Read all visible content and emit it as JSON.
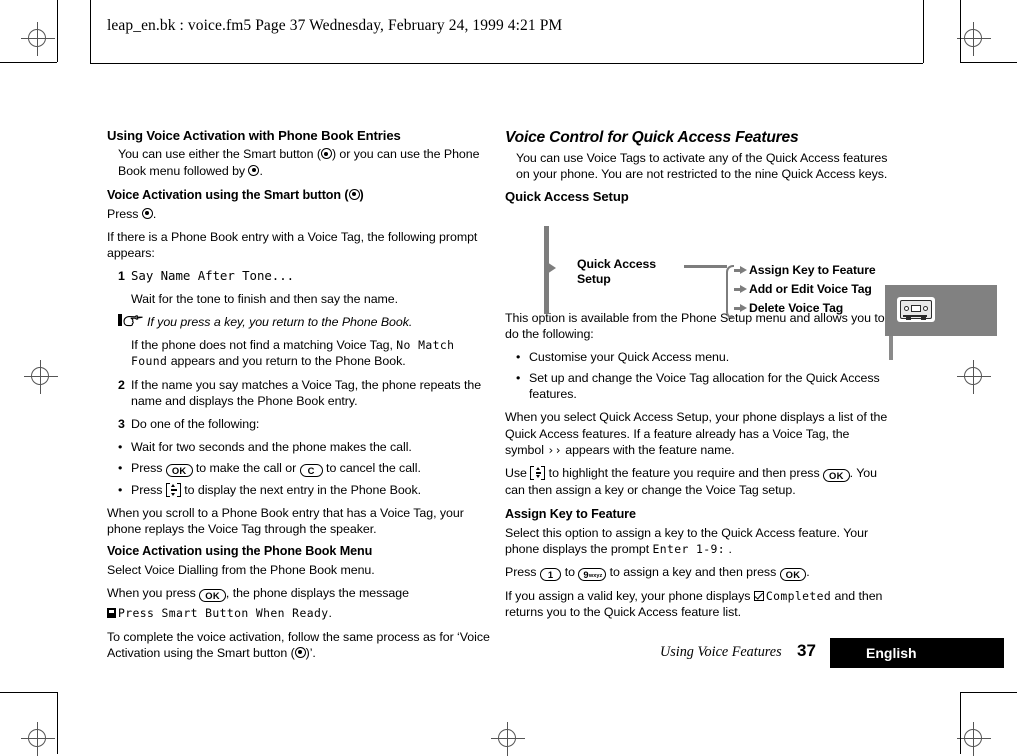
{
  "header": {
    "text": "leap_en.bk : voice.fm5  Page 37  Wednesday, February 24, 1999  4:21 PM"
  },
  "left_column": {
    "heading": "Using Voice Activation with Phone Book Entries",
    "intro_part1": "You can use either the Smart button (",
    "intro_part2": ") or you can use the Phone Book menu followed by ",
    "intro_part3": ".",
    "subheading_smart": "Voice Activation using the Smart button (",
    "subheading_smart_close": ")",
    "press_label": "Press ",
    "press_label_end": ".",
    "prompt_intro": "If there is a Phone Book entry with a Voice Tag, the following prompt appears:",
    "step1_num": "1",
    "step1_lcd": "Say Name After Tone...",
    "step1_body": "Wait for the tone to finish and then say the name.",
    "note_text": "If you press a key, you return to the Phone Book.",
    "nomatch_part1": "If the phone does not find a matching Voice Tag, ",
    "nomatch_lcd1": "No Match",
    "nomatch_lcd2": "Found",
    "nomatch_part2": " appears and you return to the Phone Book.",
    "step2_num": "2",
    "step2_body": "If the name you say matches a Voice Tag, the phone repeats the name and displays the Phone Book entry.",
    "step3_num": "3",
    "step3_body": "Do one of the following:",
    "bullet_dot": "•",
    "b1": "Wait for two seconds and the phone makes the call.",
    "b2_pre": "Press ",
    "b2_key_ok": "OK",
    "b2_mid": " to make the call or ",
    "b2_key_c": "C",
    "b2_end": " to cancel the call.",
    "b3_pre": "Press ",
    "b3_end": " to display the next entry in the Phone Book.",
    "scroll_para": "When you scroll to a Phone Book entry that has a Voice Tag, your phone replays the Voice Tag through the speaker.",
    "subheading_menu": "Voice Activation using the Phone Book Menu",
    "menu_select": "Select Voice Dialling from the Phone Book menu.",
    "menu_press_pre": "When you press ",
    "menu_press_key": "OK",
    "menu_press_post": ", the phone displays the message",
    "menu_lcd": "Press Smart Button When Ready",
    "menu_lcd_period": ".",
    "complete_part1": "To complete the voice activation, follow the same process as for ‘Voice Activation using the Smart button (",
    "complete_part2": ")’."
  },
  "right_column": {
    "heading": "Voice Control for Quick Access Features",
    "intro": "You can use Voice Tags to activate any of the Quick Access features on your phone. You are not restricted to the nine Quick Access keys.",
    "subheading_setup": "Quick Access Setup",
    "option_para": "This option is available from the Phone Setup menu and allows you to do the following:",
    "bullet_dot": "•",
    "b1": "Customise your Quick Access menu.",
    "b2": "Set up and change the Voice Tag allocation for the Quick Access features.",
    "select_part1": "When you select Quick Access Setup, your phone displays a list of the Quick Access features. If a feature already has a Voice Tag, the symbol ",
    "select_symbol": "››",
    "select_part2": " appears with the feature name.",
    "use_pre": "Use ",
    "use_mid": " to highlight the feature you require and then press ",
    "use_key_ok": "OK",
    "use_post": ". You can then assign a key or change the Voice Tag setup.",
    "subheading_assign": "Assign Key to Feature",
    "assign_part1": "Select this option to assign a key to the Quick Access feature. Your phone displays the prompt ",
    "assign_lcd": "Enter 1-9:",
    "assign_part2": " .",
    "press_pre": "Press ",
    "press_key_1": "1",
    "press_mid": " to ",
    "press_key_9": "9",
    "press_key_9_sub": "wxyz",
    "press_post": " to assign a key and then press ",
    "press_key_ok": "OK",
    "press_end": ".",
    "valid_part1": "If you assign a valid key, your phone displays ",
    "valid_lcd": "Completed",
    "valid_part2": " and then returns you to the Quick Access feature list."
  },
  "diagram": {
    "root_line1": "Quick Access",
    "root_line2": "Setup",
    "items": [
      "Assign Key to Feature",
      "Add or Edit Voice Tag",
      "Delete Voice Tag"
    ]
  },
  "side_tab": {
    "icon": "cassette-icon"
  },
  "footer": {
    "section_title": "Using Voice Features",
    "page_number": "37",
    "language": "English"
  },
  "colors": {
    "diagram_gray": "#7d7d7d",
    "tab_gray": "#818181",
    "footer_bar": "#000000"
  }
}
